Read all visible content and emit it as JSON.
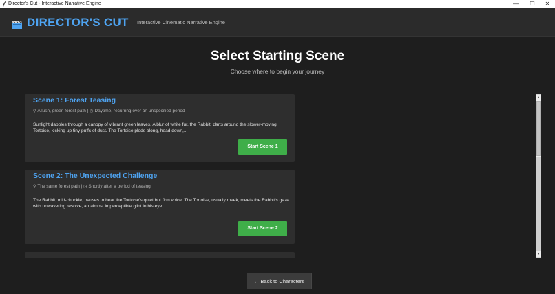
{
  "window": {
    "title": "Director's Cut - Interactive Narrative Engine",
    "controls": {
      "minimize": "—",
      "maximize": "❐",
      "close": "✕"
    }
  },
  "header": {
    "brand": "DIRECTOR'S CUT",
    "brand_icon": "clapperboard-icon",
    "tagline": "Interactive Cinematic Narrative Engine"
  },
  "main": {
    "title": "Select Starting Scene",
    "subtitle": "Choose where to begin your journey"
  },
  "scenes": [
    {
      "title": "Scene 1: Forest Teasing",
      "location": "A lush, green forest path",
      "time": "Daytime, recurring over an unspecified period",
      "description": "Sunlight dapples through a canopy of vibrant green leaves. A blur of white fur, the Rabbit, darts around the slower-moving Tortoise, kicking up tiny puffs of dust. The Tortoise plods along, head down,...",
      "button": "Start Scene 1"
    },
    {
      "title": "Scene 2: The Unexpected Challenge",
      "location": "The same forest path",
      "time": "Shortly after a period of teasing",
      "description": "The Rabbit, mid-chuckle, pauses to hear the Tortoise's quiet but firm voice. The Tortoise, usually meek, meets the Rabbit's gaze with unwavering resolve, an almost imperceptible glint in his eye.",
      "button": "Start Scene 2"
    }
  ],
  "separators": {
    "pipe": "|"
  },
  "icons": {
    "location": "pin-icon",
    "time": "clock-icon"
  },
  "colors": {
    "accent": "#4ea3f0",
    "start_button": "#3fae49",
    "background": "#1e1e1e",
    "card": "#2e2e2e"
  },
  "footer": {
    "back_button": "← Back to Characters"
  }
}
